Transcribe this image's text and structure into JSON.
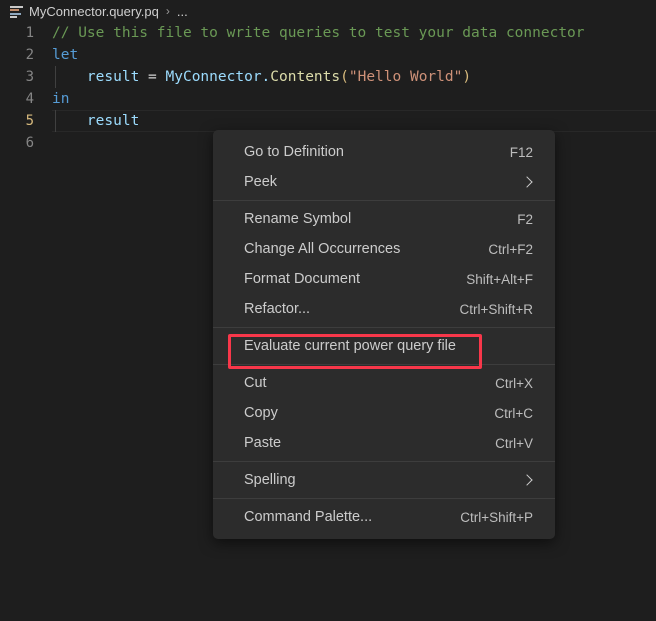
{
  "breadcrumb": {
    "icon": "symbol-list-icon",
    "file": "MyConnector.query.pq",
    "separator": "›",
    "overflow": "..."
  },
  "editor": {
    "language": "Power Query M",
    "active_line": 5,
    "lines": [
      {
        "number": "1",
        "text": "// Use this file to write queries to test your data connector"
      },
      {
        "number": "2",
        "text": "let"
      },
      {
        "number": "3",
        "text": "    result = MyConnector.Contents(\"Hello World\")"
      },
      {
        "number": "4",
        "text": "in"
      },
      {
        "number": "5",
        "text": "    result"
      },
      {
        "number": "6",
        "text": ""
      }
    ],
    "tokens": {
      "comment": "// Use this file to write queries to test your data connector",
      "let": "let",
      "result_ident": "result",
      "equals": "=",
      "call_qualifier": "MyConnector.",
      "call_member": "Contents",
      "open_paren": "(",
      "string_arg": "\"Hello World\"",
      "close_paren": ")",
      "in": "in",
      "result_return": "result"
    },
    "colors": {
      "background": "#1e1e1e",
      "comment": "#6a9955",
      "keyword": "#569cd6",
      "identifier": "#9cdcfe",
      "function": "#dcdcaa",
      "string": "#ce9178",
      "bracket": "#d7ba7d",
      "line_number": "#858585",
      "active_line_number": "#d7ba7d"
    }
  },
  "context_menu": {
    "background": "#2c2c2c",
    "groups": [
      {
        "items": [
          {
            "label": "Go to Definition",
            "shortcut": "F12",
            "submenu": false
          },
          {
            "label": "Peek",
            "shortcut": "",
            "submenu": true
          }
        ]
      },
      {
        "items": [
          {
            "label": "Rename Symbol",
            "shortcut": "F2",
            "submenu": false
          },
          {
            "label": "Change All Occurrences",
            "shortcut": "Ctrl+F2",
            "submenu": false
          },
          {
            "label": "Format Document",
            "shortcut": "Shift+Alt+F",
            "submenu": false
          },
          {
            "label": "Refactor...",
            "shortcut": "Ctrl+Shift+R",
            "submenu": false
          }
        ]
      },
      {
        "items": [
          {
            "label": "Evaluate current power query file",
            "shortcut": "",
            "submenu": false,
            "highlighted": true
          }
        ]
      },
      {
        "items": [
          {
            "label": "Cut",
            "shortcut": "Ctrl+X",
            "submenu": false
          },
          {
            "label": "Copy",
            "shortcut": "Ctrl+C",
            "submenu": false
          },
          {
            "label": "Paste",
            "shortcut": "Ctrl+V",
            "submenu": false
          }
        ]
      },
      {
        "items": [
          {
            "label": "Spelling",
            "shortcut": "",
            "submenu": true
          }
        ]
      },
      {
        "items": [
          {
            "label": "Command Palette...",
            "shortcut": "Ctrl+Shift+P",
            "submenu": false
          }
        ]
      }
    ]
  },
  "annotation": {
    "type": "highlight-rectangle",
    "color": "#f8374a",
    "targets": "Evaluate current power query file"
  }
}
